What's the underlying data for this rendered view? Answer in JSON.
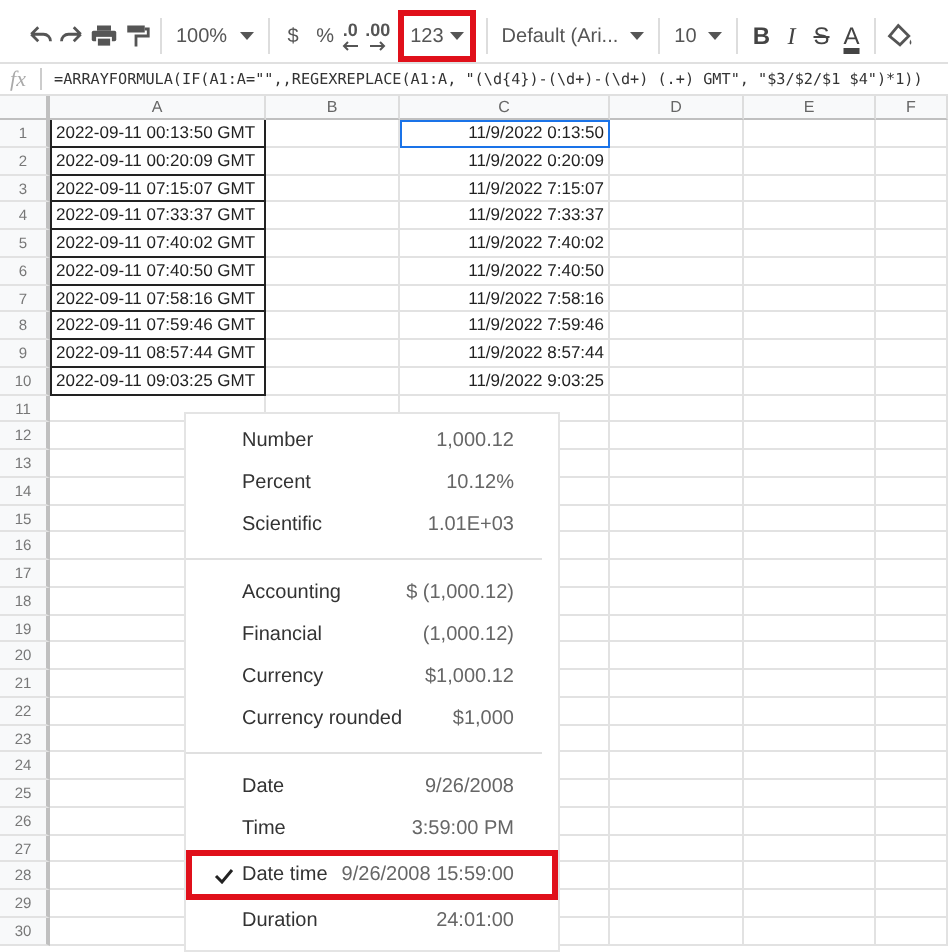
{
  "toolbar": {
    "items": [
      {
        "kind": "icon"
      },
      {
        "kind": "icon"
      },
      {
        "kind": "icon"
      },
      {
        "kind": "icon"
      },
      {
        "kind": "sep"
      },
      {
        "kind": "dropdown",
        "label": "100%",
        "annotated": false
      },
      {
        "kind": "sep"
      },
      {
        "kind": "text",
        "label": "$"
      },
      {
        "kind": "text",
        "label": "%"
      },
      {
        "kind": "decimal",
        "label": ".0"
      },
      {
        "kind": "decimal",
        "label": ".00"
      },
      {
        "kind": "dropdown",
        "label": "123",
        "annotated": true
      },
      {
        "kind": "sep"
      },
      {
        "kind": "dropdown",
        "label": "Default (Ari...",
        "annotated": false
      },
      {
        "kind": "sep"
      },
      {
        "kind": "dropdown",
        "label": "10",
        "annotated": false
      },
      {
        "kind": "sep"
      },
      {
        "kind": "format",
        "label": "B"
      },
      {
        "kind": "format",
        "label": "I"
      },
      {
        "kind": "format",
        "label": "S"
      },
      {
        "kind": "format",
        "label": "A"
      },
      {
        "kind": "sep"
      },
      {
        "kind": "icon"
      }
    ]
  },
  "formula_bar": {
    "icon": "fx",
    "formula": "=ARRAYFORMULA(IF(A1:A=\"\",,REGEXREPLACE(A1:A, \"(\\d{4})-(\\d+)-(\\d+) (.+) GMT\", \"$3/$2/$1 $4\")*1))"
  },
  "columns": [
    "A",
    "B",
    "C",
    "D",
    "E",
    "F"
  ],
  "rows": [
    {
      "number": "1",
      "a": "2022-09-11 00:13:50 GMT",
      "c": "11/9/2022 0:13:50",
      "selected": true
    },
    {
      "number": "2",
      "a": "2022-09-11 00:20:09 GMT",
      "c": "11/9/2022 0:20:09",
      "selected": false
    },
    {
      "number": "3",
      "a": "2022-09-11 07:15:07 GMT",
      "c": "11/9/2022 7:15:07",
      "selected": false
    },
    {
      "number": "4",
      "a": "2022-09-11 07:33:37 GMT",
      "c": "11/9/2022 7:33:37",
      "selected": false
    },
    {
      "number": "5",
      "a": "2022-09-11 07:40:02 GMT",
      "c": "11/9/2022 7:40:02",
      "selected": false
    },
    {
      "number": "6",
      "a": "2022-09-11 07:40:50 GMT",
      "c": "11/9/2022 7:40:50",
      "selected": false
    },
    {
      "number": "7",
      "a": "2022-09-11 07:58:16 GMT",
      "c": "11/9/2022 7:58:16",
      "selected": false
    },
    {
      "number": "8",
      "a": "2022-09-11 07:59:46 GMT",
      "c": "11/9/2022 7:59:46",
      "selected": false
    },
    {
      "number": "9",
      "a": "2022-09-11 08:57:44 GMT",
      "c": "11/9/2022 8:57:44",
      "selected": false
    },
    {
      "number": "10",
      "a": "2022-09-11 09:03:25 GMT",
      "c": "11/9/2022 9:03:25",
      "selected": false
    },
    {
      "number": "11"
    },
    {
      "number": "12"
    },
    {
      "number": "13"
    },
    {
      "number": "14"
    },
    {
      "number": "15"
    },
    {
      "number": "16"
    },
    {
      "number": "17"
    },
    {
      "number": "18"
    },
    {
      "number": "19"
    },
    {
      "number": "20"
    },
    {
      "number": "21"
    },
    {
      "number": "22"
    },
    {
      "number": "23"
    },
    {
      "number": "24"
    },
    {
      "number": "25"
    },
    {
      "number": "26"
    },
    {
      "number": "27"
    },
    {
      "number": "28"
    },
    {
      "number": "29"
    },
    {
      "number": "30"
    }
  ],
  "format_menu": {
    "groups": [
      [
        {
          "label": "Number",
          "example": "1,000.12",
          "checked": false,
          "annotated": false
        },
        {
          "label": "Percent",
          "example": "10.12%",
          "checked": false,
          "annotated": false
        },
        {
          "label": "Scientific",
          "example": "1.01E+03",
          "checked": false,
          "annotated": false
        }
      ],
      [
        {
          "label": "Accounting",
          "example": "$ (1,000.12)",
          "checked": false,
          "annotated": false
        },
        {
          "label": "Financial",
          "example": "(1,000.12)",
          "checked": false,
          "annotated": false
        },
        {
          "label": "Currency",
          "example": "$1,000.12",
          "checked": false,
          "annotated": false
        },
        {
          "label": "Currency rounded",
          "example": "$1,000",
          "checked": false,
          "annotated": false
        }
      ],
      [
        {
          "label": "Date",
          "example": "9/26/2008",
          "checked": false,
          "annotated": false
        },
        {
          "label": "Time",
          "example": "3:59:00 PM",
          "checked": false,
          "annotated": false
        },
        {
          "label": "Date time",
          "example": "9/26/2008 15:59:00",
          "checked": true,
          "annotated": true
        },
        {
          "label": "Duration",
          "example": "24:01:00",
          "checked": false,
          "annotated": false
        }
      ]
    ]
  }
}
